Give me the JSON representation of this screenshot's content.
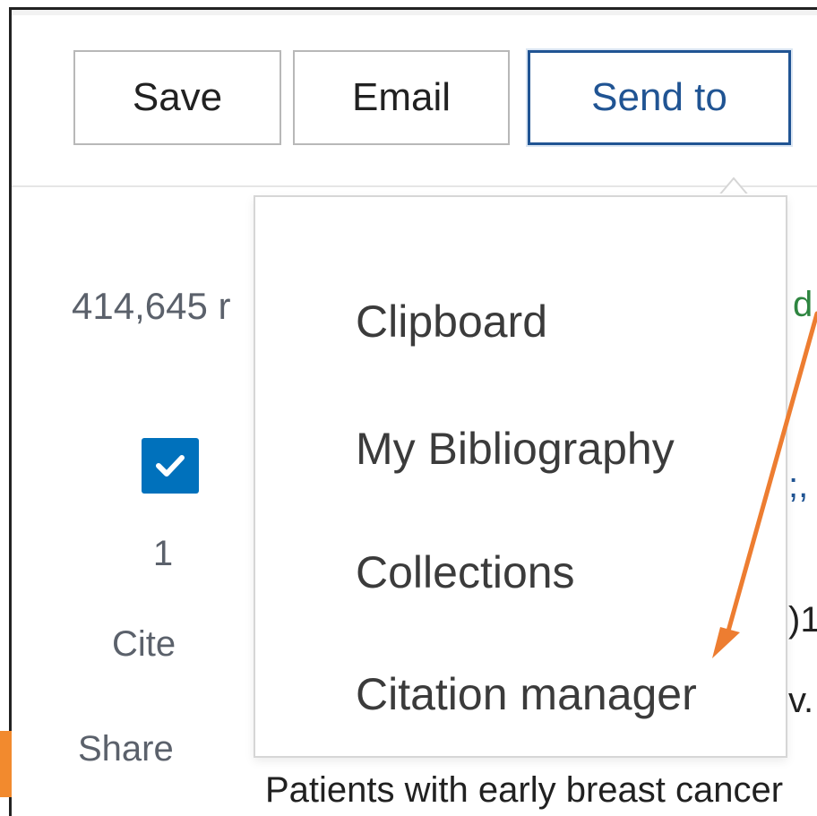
{
  "toolbar": {
    "save_label": "Save",
    "email_label": "Email",
    "send_to_label": "Send to"
  },
  "results": {
    "count_text": "414,645 r",
    "first_result": {
      "number": "1",
      "cite_label": "Cite",
      "share_label": "Share",
      "checked": true
    }
  },
  "background_fragments": {
    "green": "d",
    "blue": ";,",
    "dark1": ")1",
    "dark2": "v.",
    "bottom": "Patients with early breast cancer"
  },
  "send_to_menu": {
    "items": [
      {
        "label": "Clipboard"
      },
      {
        "label": "My Bibliography"
      },
      {
        "label": "Collections"
      },
      {
        "label": "Citation manager"
      }
    ]
  },
  "colors": {
    "accent_blue": "#205493",
    "checkbox_blue": "#0071bc",
    "annotation_orange": "#ed7d31"
  }
}
